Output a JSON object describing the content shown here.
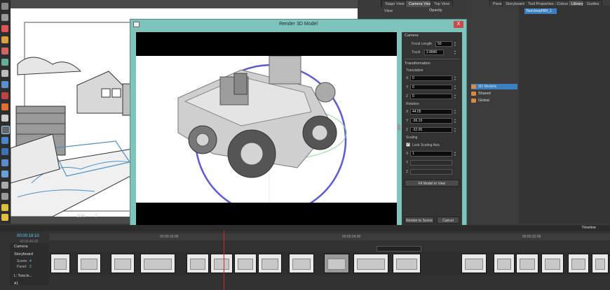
{
  "toolbar": {
    "tools": [
      "select-icon",
      "brush-icon",
      "pencil-icon",
      "eraser-icon",
      "paint-icon",
      "text-icon",
      "shape-icon",
      "fill-icon",
      "dropper-icon",
      "hand-icon",
      "transform-icon",
      "crop-icon",
      "camera-icon",
      "node-icon",
      "layer-icon",
      "lock-icon",
      "light-icon"
    ]
  },
  "stage": {
    "tabs": [
      "Stage View",
      "Camera View",
      "Top View"
    ],
    "active_tab": "Camera View",
    "opacity_label": "Opacity",
    "zoom": "50%",
    "frame": "0"
  },
  "panel_tabs": [
    "Panel",
    "Storyboard",
    "Tool Properties : Colour",
    "Library",
    "Guides"
  ],
  "library": {
    "selected_item": "ToonJeepFBX_1",
    "tree": [
      {
        "label": "3D Models",
        "selected": true
      },
      {
        "label": "Shared",
        "selected": false
      },
      {
        "label": "Global",
        "selected": false
      }
    ]
  },
  "dialog": {
    "title": "Render 3D Model",
    "close_label": "X",
    "camera": {
      "section": "Camera",
      "focal_length_label": "Focal Length",
      "focal_length": "50",
      "truck_label": "Truck",
      "truck": "2.8845"
    },
    "transformation": {
      "section": "Transformation",
      "translation_label": "Translation",
      "translation": {
        "x": "0",
        "y": "0",
        "z": "0"
      },
      "rotation_label": "Rotation",
      "rotation": {
        "x": "44.05",
        "y": "-36.19",
        "z": "-32.05"
      },
      "scaling_label": "Scaling",
      "lock_scaling_label": "Lock Scaling Axis",
      "lock_scaling": true,
      "scaling": {
        "x": "1",
        "y": "",
        "z": ""
      }
    },
    "fit_button": "Fit Model to View",
    "render_button": "Render to Scene",
    "cancel_button": "Cancel"
  },
  "timeline": {
    "title": "Timeline",
    "timecode": "00:00:18:10",
    "timecode_sub": "00:00:46:00",
    "ruler_labels": [
      "00:00:16:00",
      "00:00:24:00",
      "00:00:32:00"
    ],
    "track_camera": "Camera",
    "track_storyboard": "Storyboard",
    "scene_label": "Scene:",
    "scene_value": "4",
    "panel_label": "Panel:",
    "panel_value": "2",
    "layer_label": "L: ToonJe...",
    "audio_label": "A1",
    "clip_count": 18
  },
  "colors": {
    "dialog_frame": "#7fc4bc",
    "selection": "#3a7fc0",
    "playhead": "#e02020",
    "close": "#c94a4a"
  }
}
